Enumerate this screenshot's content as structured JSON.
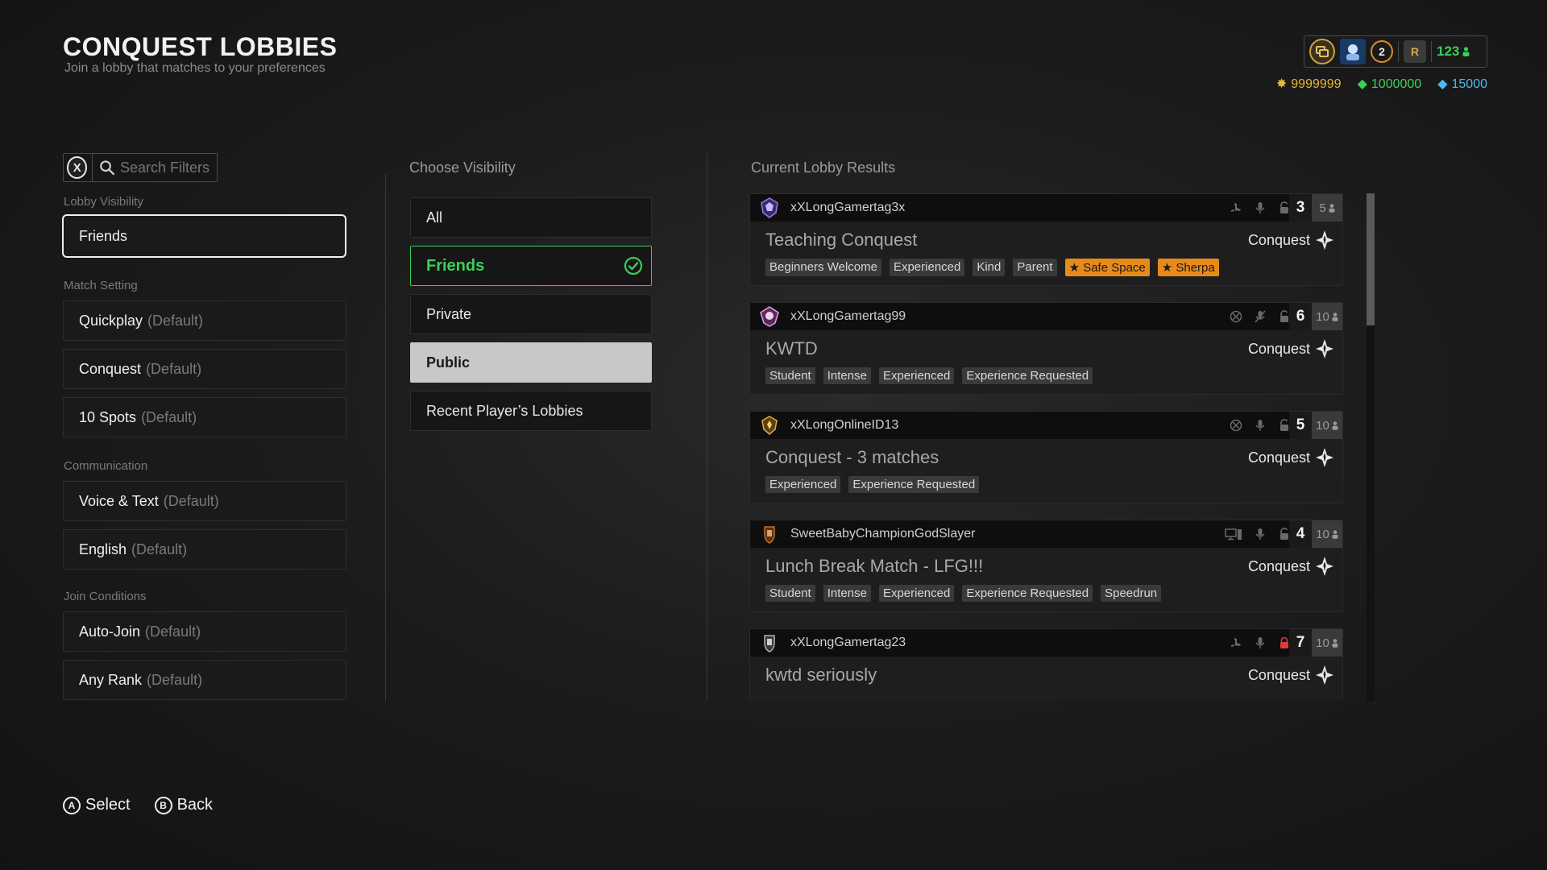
{
  "header": {
    "title": "CONQUEST LOBBIES",
    "subtitle": "Join a lobby that matches to your preferences"
  },
  "currency": {
    "badge_number": "2",
    "rank_letter": "R",
    "player_count": "123",
    "gold": "9999999",
    "green": "1000000",
    "gems": "15000"
  },
  "search": {
    "button": "X",
    "placeholder": "Search Filters"
  },
  "filters": {
    "visibility_label": "Lobby Visibility",
    "visibility_value": "Friends",
    "match_label": "Match Setting",
    "match": [
      {
        "value": "Quickplay",
        "suffix": "(Default)"
      },
      {
        "value": "Conquest",
        "suffix": "(Default)"
      },
      {
        "value": "10 Spots",
        "suffix": "(Default)"
      }
    ],
    "comm_label": "Communication",
    "comm": [
      {
        "value": "Voice & Text",
        "suffix": "(Default)"
      },
      {
        "value": "English",
        "suffix": "(Default)"
      }
    ],
    "join_label": "Join Conditions",
    "join": [
      {
        "value": "Auto-Join",
        "suffix": "(Default)"
      },
      {
        "value": "Any Rank",
        "suffix": "(Default)"
      }
    ]
  },
  "visibility": {
    "title": "Choose Visibility",
    "options": [
      "All",
      "Friends",
      "Private",
      "Public",
      "Recent Player’s Lobbies"
    ],
    "selected": "Friends",
    "focused": "Public"
  },
  "results": {
    "title": "Current Lobby Results",
    "lobbies": [
      {
        "gamertag": "xXLongGamertag3x",
        "name": "Teaching Conquest",
        "mode": "Conquest",
        "current": "3",
        "max": "5",
        "platform": "playstation",
        "locked": false,
        "tags": [
          {
            "text": "Beginners Welcome"
          },
          {
            "text": "Experienced"
          },
          {
            "text": "Kind"
          },
          {
            "text": "Parent"
          },
          {
            "text": "★ Safe Space",
            "gold": true
          },
          {
            "text": "★ Sherpa",
            "gold": true
          }
        ]
      },
      {
        "gamertag": "xXLongGamertag99",
        "name": "KWTD",
        "mode": "Conquest",
        "current": "6",
        "max": "10",
        "platform": "xbox",
        "locked": false,
        "tags": [
          {
            "text": "Student"
          },
          {
            "text": "Intense"
          },
          {
            "text": "Experienced"
          },
          {
            "text": "Experience Requested"
          }
        ]
      },
      {
        "gamertag": "xXLongOnlineID13",
        "name": "Conquest - 3 matches",
        "mode": "Conquest",
        "current": "5",
        "max": "10",
        "platform": "xbox",
        "locked": false,
        "tags": [
          {
            "text": "Experienced"
          },
          {
            "text": "Experience Requested"
          }
        ]
      },
      {
        "gamertag": "SweetBabyChampionGodSlayer",
        "name": "Lunch Break Match - LFG!!!",
        "mode": "Conquest",
        "current": "4",
        "max": "10",
        "platform": "pc",
        "locked": false,
        "tags": [
          {
            "text": "Student"
          },
          {
            "text": "Intense"
          },
          {
            "text": "Experienced"
          },
          {
            "text": "Experience Requested"
          },
          {
            "text": "Speedrun"
          }
        ]
      },
      {
        "gamertag": "xXLongGamertag23",
        "name": "kwtd seriously",
        "mode": "Conquest",
        "current": "7",
        "max": "10",
        "platform": "playstation",
        "locked": true,
        "tags": []
      }
    ]
  },
  "footer": {
    "select_btn": "A",
    "select_label": "Select",
    "back_btn": "B",
    "back_label": "Back"
  },
  "colors": {
    "accent_green": "#3ccf5a",
    "gold_tag": "#e88a1a",
    "lock_red": "#e03a3a"
  }
}
